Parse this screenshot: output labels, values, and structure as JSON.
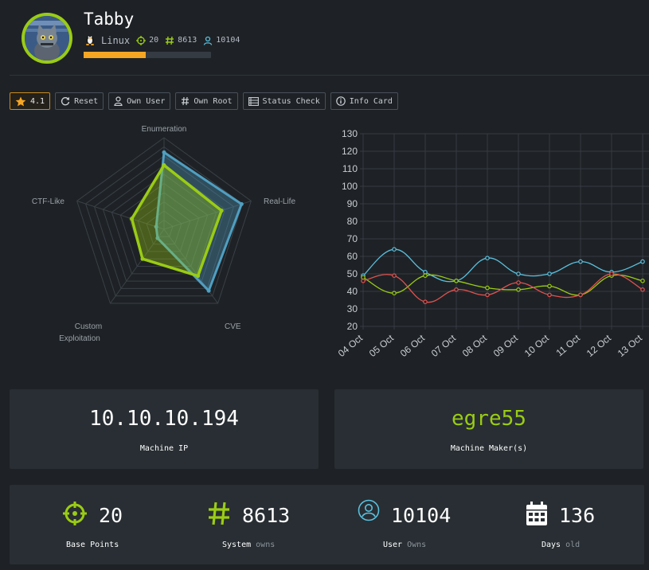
{
  "machine": {
    "name": "Tabby",
    "os": "Linux",
    "points": "20",
    "system_owns": "8613",
    "user_owns": "10104",
    "progress": 0.49
  },
  "toolbar": {
    "rating": "4.1",
    "reset": "Reset",
    "own_user": "Own User",
    "own_root": "Own Root",
    "status_check": "Status Check",
    "info_card": "Info Card"
  },
  "radar": {
    "axes": [
      "Enumeration",
      "Real-Life",
      "CVE",
      "Custom",
      "Exploitation",
      "CTF-Like"
    ],
    "scale_max": 10,
    "series": [
      {
        "color": "#4f9fc1",
        "values": [
          8.4,
          8.9,
          8.3,
          1.2,
          0.9
        ]
      },
      {
        "color": "#9acc14",
        "values": [
          7.0,
          6.6,
          6.3,
          4.0,
          3.7
        ]
      }
    ]
  },
  "chart_data": {
    "type": "line",
    "categories": [
      "04 Oct",
      "05 Oct",
      "06 Oct",
      "07 Oct",
      "08 Oct",
      "09 Oct",
      "10 Oct",
      "11 Oct",
      "12 Oct",
      "13 Oct"
    ],
    "ylim": [
      20,
      130
    ],
    "yticks": [
      "130",
      "120",
      "110",
      "100",
      "90",
      "80",
      "70",
      "60",
      "50",
      "40",
      "30",
      "20"
    ],
    "grid": true,
    "series": [
      {
        "color": "#5bc0de",
        "values": [
          49,
          64,
          51,
          46,
          59,
          50,
          50,
          57,
          51,
          57
        ]
      },
      {
        "color": "#9acc14",
        "values": [
          48,
          39,
          49,
          46,
          42,
          41,
          43,
          38,
          49,
          46
        ]
      },
      {
        "color": "#e0524f",
        "values": [
          46,
          49,
          34,
          41,
          38,
          45,
          38,
          38,
          50,
          41
        ]
      }
    ]
  },
  "cards": {
    "ip": "10.10.10.194",
    "ip_label": "Machine IP",
    "maker": "egre55",
    "maker_label": "Machine Maker(s)"
  },
  "stats": {
    "base_points": "20",
    "base_points_label": "Base Points",
    "system": "8613",
    "system_label": "System",
    "system_suffix": "owns",
    "user": "10104",
    "user_label": "User",
    "user_suffix": "Owns",
    "days": "136",
    "days_label": "Days",
    "days_suffix": "old"
  },
  "colors": {
    "accent": "#9acc14",
    "rating": "#f5a623",
    "user": "#5bc0de"
  }
}
